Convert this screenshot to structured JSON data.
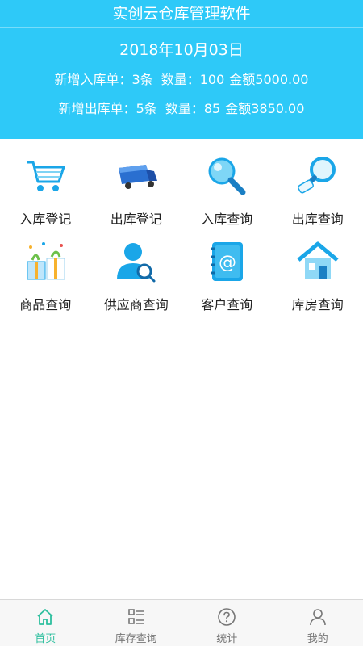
{
  "app": {
    "title": "实创云仓库管理软件"
  },
  "summary": {
    "date": "2018年10月03日",
    "inbound": {
      "label": "新增入库单：",
      "count": "3条",
      "qty_label": "数量：",
      "qty": "100",
      "amount_label": "金额",
      "amount": "5000.00"
    },
    "outbound": {
      "label": "新增出库单：",
      "count": "5条",
      "qty_label": "数量：",
      "qty": "85",
      "amount_label": "金额",
      "amount": "3850.00"
    }
  },
  "menu": [
    {
      "label": "入库登记",
      "icon": "cart-icon"
    },
    {
      "label": "出库登记",
      "icon": "truck-icon"
    },
    {
      "label": "入库查询",
      "icon": "magnifier-icon"
    },
    {
      "label": "出库查询",
      "icon": "search-scroll-icon"
    },
    {
      "label": "商品查询",
      "icon": "gift-icon"
    },
    {
      "label": "供应商查询",
      "icon": "user-search-icon"
    },
    {
      "label": "客户查询",
      "icon": "address-book-icon"
    },
    {
      "label": "库房查询",
      "icon": "house-icon"
    }
  ],
  "tabs": [
    {
      "label": "首页",
      "icon": "home-icon",
      "active": true
    },
    {
      "label": "库存查询",
      "icon": "list-icon",
      "active": false
    },
    {
      "label": "统计",
      "icon": "question-icon",
      "active": false
    },
    {
      "label": "我的",
      "icon": "person-icon",
      "active": false
    }
  ],
  "colors": {
    "header_bg": "#2ec9f8",
    "active_tab": "#2dbf9e",
    "icon_blue": "#1aa6e8"
  }
}
